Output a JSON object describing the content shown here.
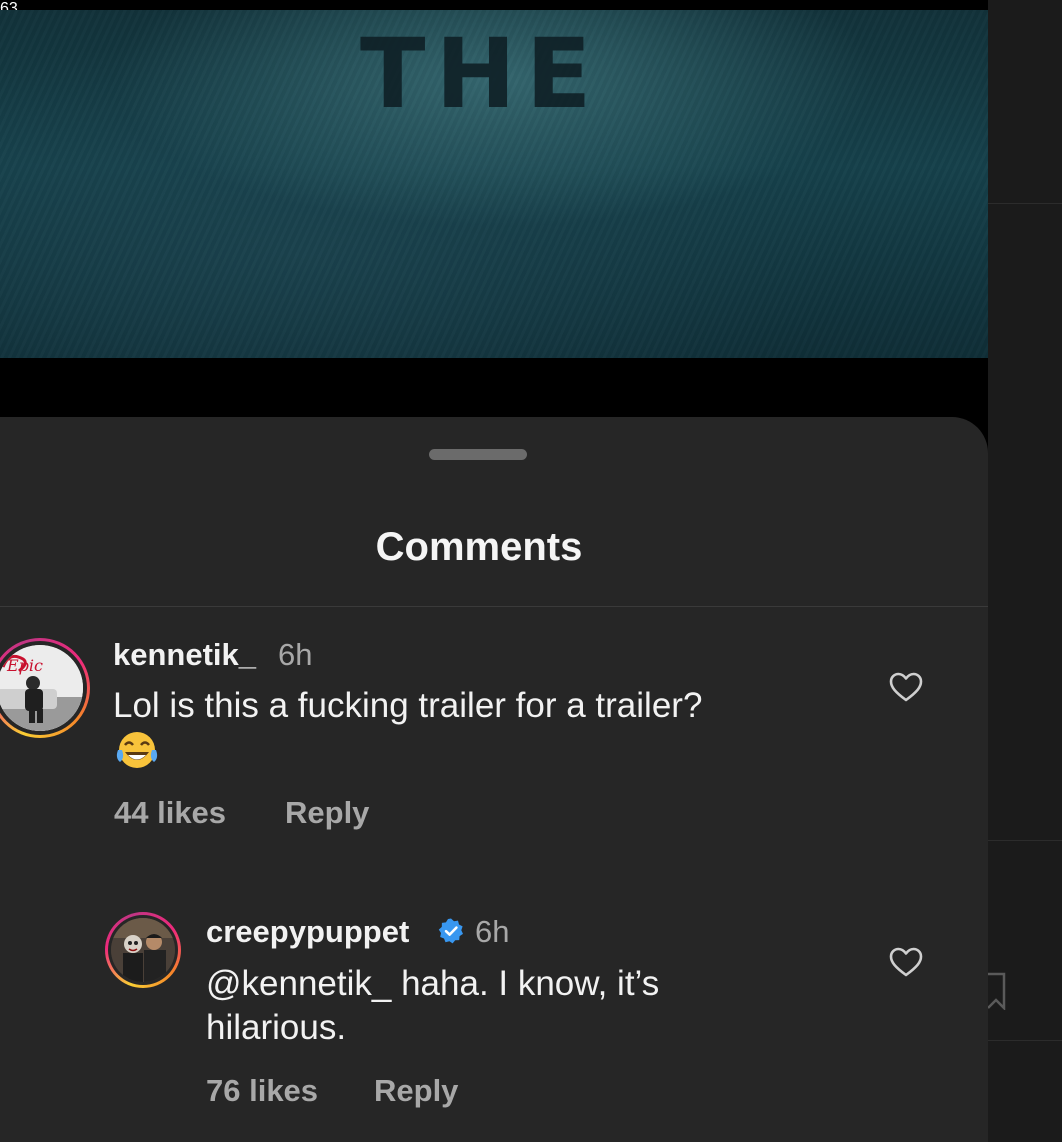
{
  "media": {
    "title_text": "THE"
  },
  "sheet": {
    "title": "Comments"
  },
  "comments": [
    {
      "username": "kennetik_",
      "time": "6h",
      "text": "Lol is this a fucking trailer for a trailer?",
      "emoji": "face-with-tears-of-joy",
      "likes": "44 likes",
      "reply_label": "Reply",
      "avatar_text": "Epic"
    },
    {
      "username": "creepypuppet",
      "verified": true,
      "time": "6h",
      "text_line1": "@kennetik_ haha. I know, it’s",
      "text_line2": "hilarious.",
      "likes": "76 likes",
      "reply_label": "Reply"
    }
  ],
  "backdrop": {
    "count_partial": "63"
  },
  "colors": {
    "sheet_bg": "#262626",
    "muted_text": "#a8a8a8",
    "verified_blue": "#3897f0"
  }
}
